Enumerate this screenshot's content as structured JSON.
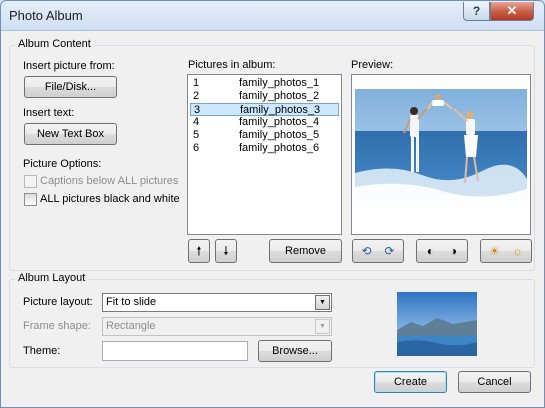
{
  "window": {
    "title": "Photo Album",
    "help_glyph": "?",
    "close_glyph": "✕"
  },
  "album_content": {
    "label": "Album Content",
    "insert_picture_label": "Insert picture from:",
    "file_disk_button": "File/Disk...",
    "insert_text_label": "Insert text:",
    "new_text_box_button": "New Text Box",
    "picture_options_label": "Picture Options:",
    "captions_label": "Captions below ALL pictures",
    "captions_checked": false,
    "captions_enabled": false,
    "black_white_label": "ALL pictures black and white",
    "black_white_checked": false
  },
  "pictures": {
    "label": "Pictures in album:",
    "items": [
      {
        "num": "1",
        "name": "family_photos_1",
        "selected": false
      },
      {
        "num": "2",
        "name": "family_photos_2",
        "selected": false
      },
      {
        "num": "3",
        "name": "family_photos_3",
        "selected": true
      },
      {
        "num": "4",
        "name": "family_photos_4",
        "selected": false
      },
      {
        "num": "5",
        "name": "family_photos_5",
        "selected": false
      },
      {
        "num": "6",
        "name": "family_photos_6",
        "selected": false
      }
    ],
    "move_up_glyph": "🠕",
    "move_down_glyph": "🠗",
    "remove_button": "Remove"
  },
  "preview": {
    "label": "Preview:"
  },
  "album_layout": {
    "label": "Album Layout",
    "picture_layout_label": "Picture layout:",
    "picture_layout_value": "Fit to slide",
    "frame_shape_label": "Frame shape:",
    "frame_shape_value": "Rectangle",
    "frame_shape_enabled": false,
    "theme_label": "Theme:",
    "theme_value": "",
    "browse_button": "Browse..."
  },
  "footer": {
    "create_button": "Create",
    "cancel_button": "Cancel"
  },
  "colors": {
    "selection": "#cce8ff",
    "sea": "#2c6fb6",
    "sky": "#9fc6ea"
  }
}
